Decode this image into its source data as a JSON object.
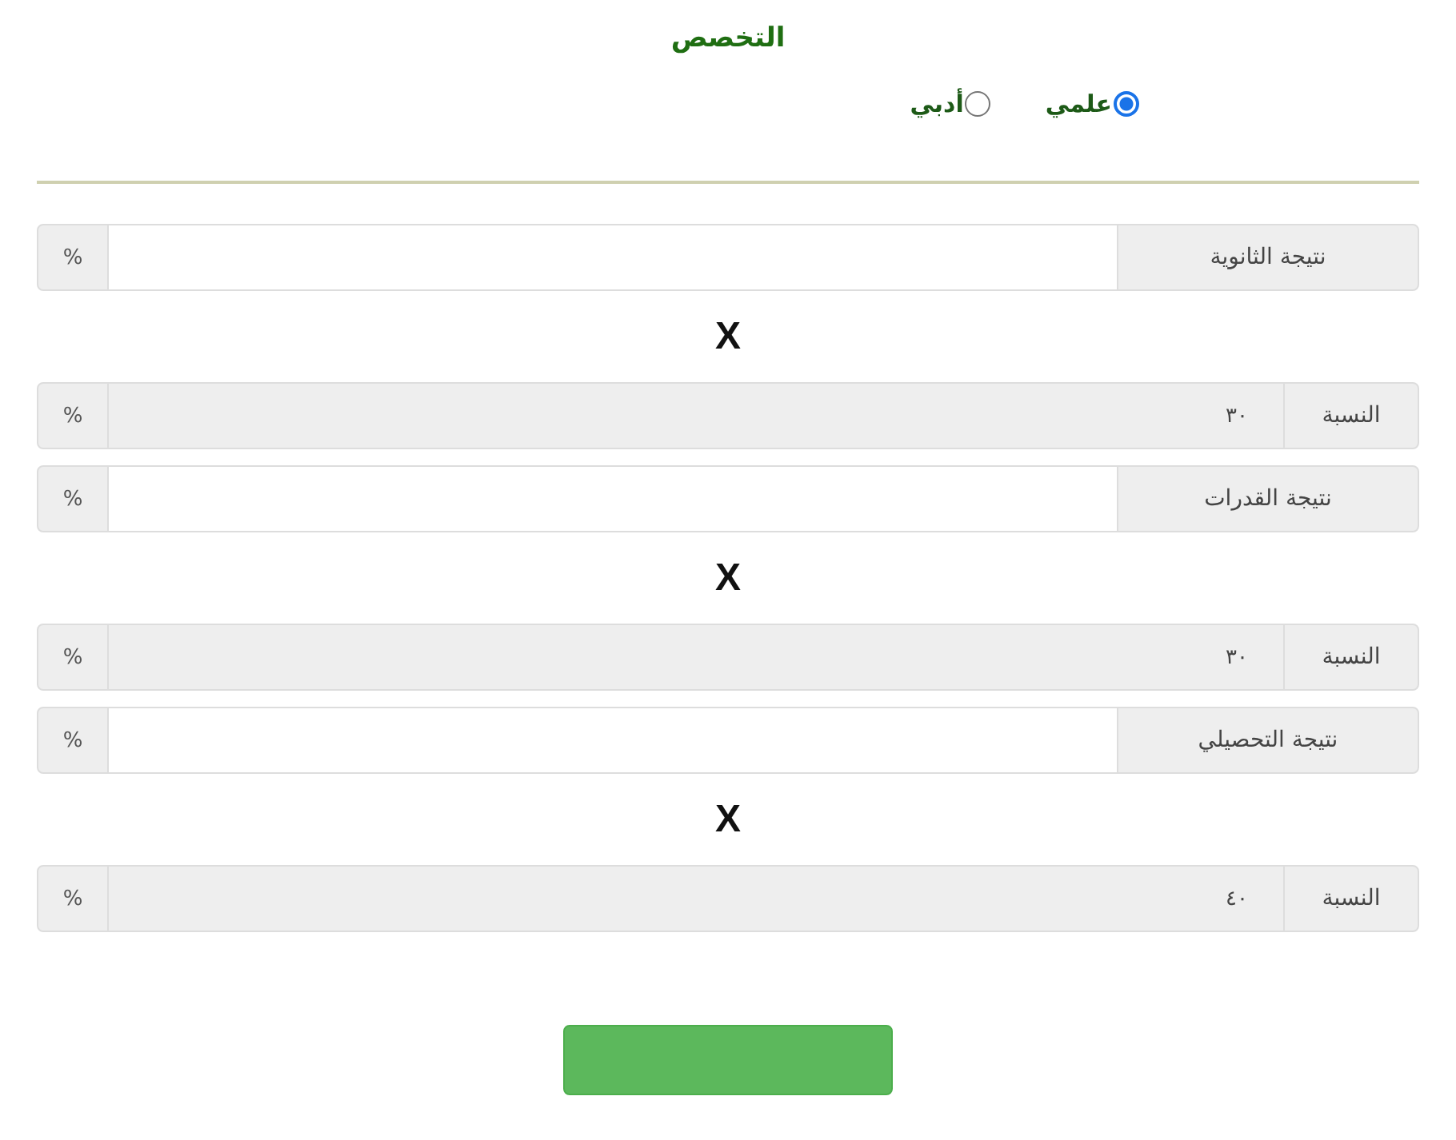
{
  "specialization": {
    "title": "التخصص",
    "options": [
      {
        "label": "علمي",
        "selected": true
      },
      {
        "label": "أدبي",
        "selected": false
      }
    ]
  },
  "groups": [
    {
      "result": {
        "label": "نتيجة الثانوية",
        "unit": "%",
        "disabled": false
      },
      "operator": "X",
      "weight": {
        "label": "النسبة",
        "value": "٣٠",
        "unit": "%",
        "disabled": true
      }
    },
    {
      "result": {
        "label": "نتيجة القدرات",
        "unit": "%",
        "disabled": false
      },
      "operator": "X",
      "weight": {
        "label": "النسبة",
        "value": "٣٠",
        "unit": "%",
        "disabled": true
      }
    },
    {
      "result": {
        "label": "نتيجة التحصيلي",
        "unit": "%",
        "disabled": false
      },
      "operator": "X",
      "weight": {
        "label": "النسبة",
        "value": "٤٠",
        "unit": "%",
        "disabled": true
      }
    }
  ],
  "buttons": [
    {
      "kind": "submit"
    }
  ]
}
